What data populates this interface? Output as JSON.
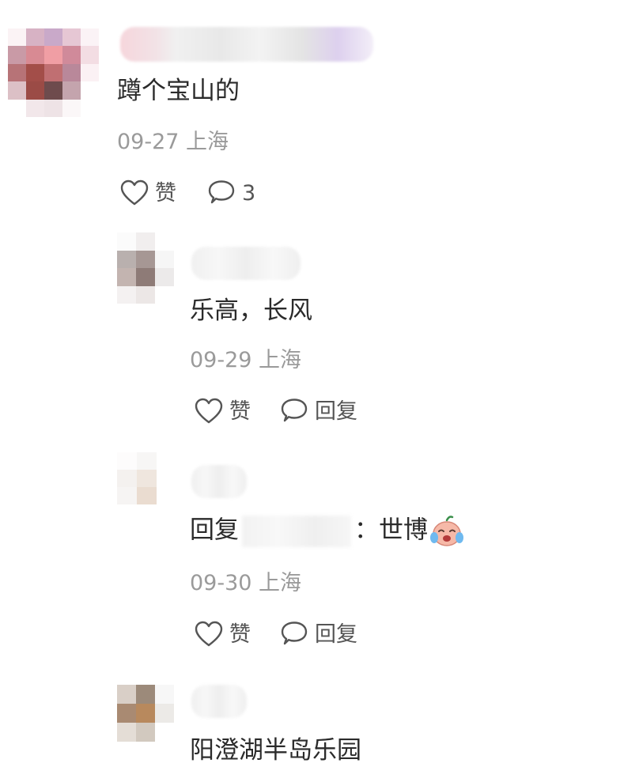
{
  "comments": [
    {
      "text": "蹲个宝山的",
      "date": "09-27 上海",
      "like_label": "赞",
      "reply_count": "3",
      "replies": [
        {
          "text": "乐高，长风",
          "date": "09-29 上海",
          "like_label": "赞",
          "reply_label": "回复"
        },
        {
          "reply_prefix": "回复",
          "reply_suffix": "：世博",
          "date": "09-30 上海",
          "like_label": "赞",
          "reply_label": "回复"
        },
        {
          "text": "阳澄湖半岛乐园"
        }
      ]
    }
  ],
  "icons": {
    "like": "heart-outline-icon",
    "comment": "speech-bubble-icon",
    "emoji": "crying-laughing-face-icon"
  },
  "colors": {
    "text": "#2b2b2b",
    "meta": "#9a9a9a",
    "action": "#555555"
  }
}
